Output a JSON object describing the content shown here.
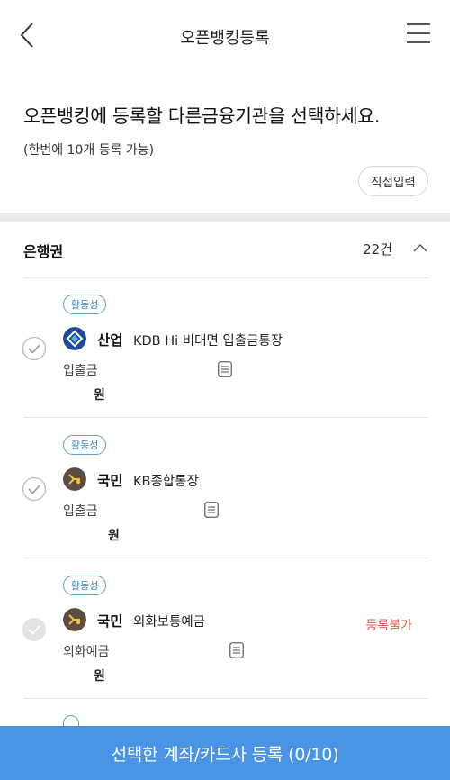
{
  "header": {
    "title": "오픈뱅킹등록"
  },
  "intro": {
    "main": "오픈뱅킹에 등록할 다른금융기관을 선택하세요.",
    "sub": "(한번에 10개 등록 가능)",
    "direct_input_label": "직접입력"
  },
  "section": {
    "title": "은행권",
    "count": "22건"
  },
  "accounts": [
    {
      "badge": "활동성",
      "bank": "산업",
      "name": "KDB Hi 비대면 입출금통장",
      "type": "입출금",
      "won": "원",
      "status": "",
      "logo_color": "#1d4a9c",
      "check_state": "selectable"
    },
    {
      "badge": "활동성",
      "bank": "국민",
      "name": "KB종합통장",
      "type": "입출금",
      "won": "원",
      "status": "",
      "logo_color": "#5b4d3f",
      "check_state": "selectable"
    },
    {
      "badge": "활동성",
      "bank": "국민",
      "name": "외화보통예금",
      "type": "외화예금",
      "won": "원",
      "status": "등록불가",
      "logo_color": "#5b4d3f",
      "check_state": "disabled"
    }
  ],
  "cta": {
    "label": "선택한 계좌/카드사 등록 (0/10)"
  },
  "colors": {
    "accent": "#4a94e6",
    "badge": "#3d86b8",
    "error": "#e05b4a"
  }
}
